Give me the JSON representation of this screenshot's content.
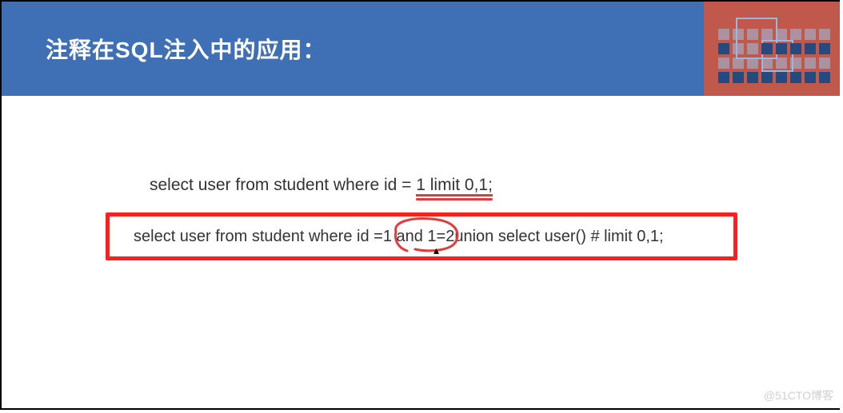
{
  "header": {
    "title": "注释在SQL注入中的应用："
  },
  "content": {
    "sql_line1_prefix": "select user from student where id = ",
    "sql_line1_underlined": "1 limit 0,1;",
    "sql_line2_prefix": "select user from student where id =",
    "sql_line2_circled": " 1 and 1=2 ",
    "sql_line2_suffix": "union select user() # limit 0,1;"
  },
  "watermark": "@51CTO博客"
}
